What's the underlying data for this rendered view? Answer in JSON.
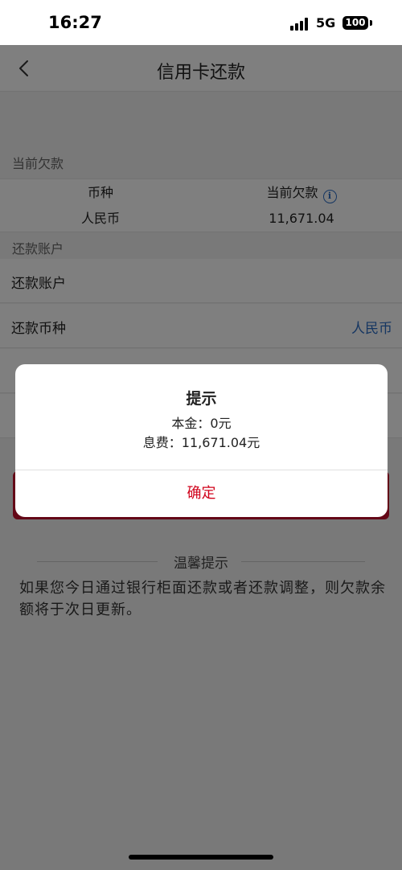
{
  "status_bar": {
    "time": "16:27",
    "network": "5G",
    "battery": "100"
  },
  "nav": {
    "title": "信用卡还款",
    "back_icon": "chevron-left-icon"
  },
  "current_debt": {
    "section_label": "当前欠款",
    "headers": [
      "币种",
      "当前欠款"
    ],
    "info_icon": "info-icon",
    "info_glyph": "i",
    "rows": [
      {
        "currency": "人民币",
        "amount": "11,671.04"
      }
    ]
  },
  "repay_account": {
    "section_label": "还款账户",
    "items": [
      {
        "label": "还款账户",
        "value": ""
      },
      {
        "label": "还款币种",
        "value": "人民币"
      }
    ]
  },
  "tips": {
    "title": "温馨提示",
    "text": "如果您今日通过银行柜面还款或者还款调整，则欠款余额将于次日更新。"
  },
  "dialog": {
    "title": "提示",
    "lines": [
      "本金：0元",
      "息费：11,671.04元"
    ],
    "confirm_label": "确定"
  },
  "colors": {
    "accent_blue": "#2b6cc4",
    "brand_red": "#c8102e",
    "confirm_red": "#d0021b"
  }
}
